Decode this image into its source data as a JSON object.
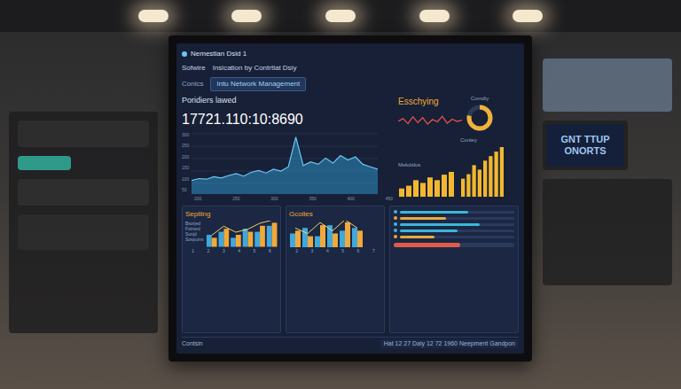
{
  "screen": {
    "title": "Nemestian Dsid 1",
    "menu": [
      "Sofwire",
      "Insication by Contrtlat Dsiy"
    ],
    "side_label": "Conics",
    "tab": {
      "label": "Intu Network Management",
      "selected": true
    },
    "main_panel": {
      "title": "Poridiers lawed",
      "value": "17721.110:10:8690",
      "y_ticks": [
        "300",
        "250",
        "200",
        "150",
        "100",
        "50"
      ],
      "x_ticks": [
        "200",
        "250",
        "300",
        "350",
        "400",
        "450"
      ],
      "series": [
        22,
        25,
        24,
        28,
        26,
        30,
        33,
        29,
        35,
        38,
        34,
        40,
        37,
        44,
        92,
        46,
        52,
        48,
        58,
        50,
        62,
        55,
        60,
        48,
        44,
        40
      ]
    },
    "wave_panel": {
      "title": "Esschying",
      "series": [
        50,
        62,
        40,
        70,
        45,
        66,
        38,
        58,
        48,
        72,
        42,
        60,
        50,
        55
      ]
    },
    "donut": {
      "label": "Comdiy",
      "level": 0.78
    },
    "bars_a": {
      "title": "Mekdslos",
      "values": [
        3,
        4,
        6,
        5,
        7,
        6,
        8,
        9
      ]
    },
    "bars_b": {
      "title": "Conley",
      "values": [
        4,
        5,
        7,
        6,
        8,
        9,
        10,
        11
      ]
    },
    "bottom_panels": [
      {
        "title": "Sepliing",
        "labels": [
          "Bsorjed",
          "Foirsed",
          "Sunjd",
          "Sospuins"
        ],
        "ticks": [
          "1",
          "2",
          "3",
          "4",
          "5",
          "6"
        ],
        "blue": [
          4,
          5,
          3,
          6,
          5,
          7
        ],
        "orange": [
          3,
          6,
          4,
          5,
          7,
          8
        ]
      },
      {
        "title": "Gcolles",
        "labels": [],
        "ticks": [
          "2",
          "3",
          "4",
          "5",
          "6",
          "7"
        ],
        "blue": [
          5,
          7,
          4,
          8,
          6,
          7
        ],
        "orange": [
          6,
          4,
          8,
          5,
          9,
          6
        ]
      }
    ],
    "table": {
      "rows": [
        {
          "level": 0.6,
          "color": "#3fb6d9"
        },
        {
          "level": 0.4,
          "color": "#e8a93a"
        },
        {
          "level": 0.7,
          "color": "#3fb6d9"
        },
        {
          "level": 0.5,
          "color": "#3fb6d9"
        },
        {
          "level": 0.3,
          "color": "#e8a93a"
        }
      ]
    },
    "alert_bar": {
      "level": 0.55,
      "color": "#e25a4a"
    },
    "footer": {
      "label": "Contsin",
      "status": "Hat 12 27 Daly 12 72 1960 Neepment Gandpon"
    }
  },
  "background_screen": {
    "text": "GNT TTUP ONORTS"
  }
}
